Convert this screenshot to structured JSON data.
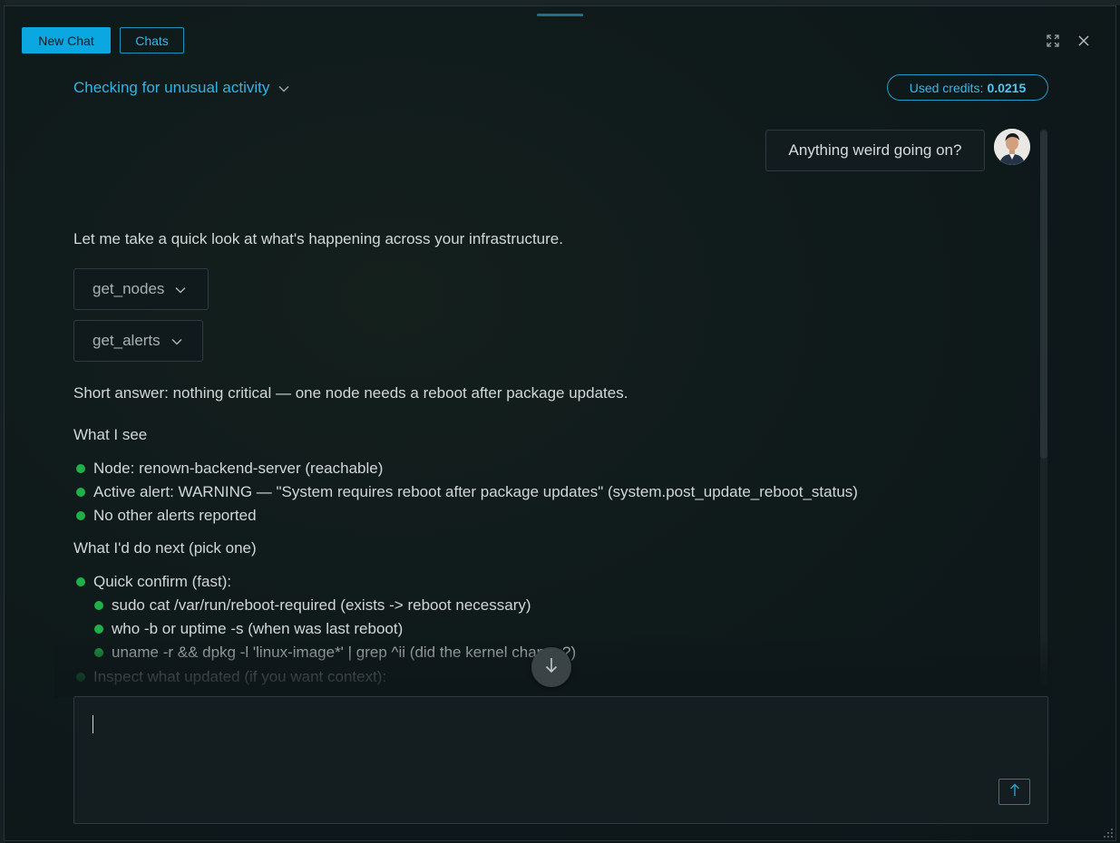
{
  "toolbar": {
    "new_chat_label": "New Chat",
    "chats_label": "Chats"
  },
  "header": {
    "conversation_title": "Checking for unusual activity",
    "credits_label": "Used credits:",
    "credits_value": "0.0215"
  },
  "messages": {
    "user_message": "Anything weird going on?",
    "assistant_intro": "Let me take a quick look at what's happening across your infrastructure.",
    "tool_calls": [
      "get_nodes",
      "get_alerts"
    ],
    "summary": "Short answer: nothing critical — one node needs a reboot after package updates.",
    "what_i_see_heading": "What I see",
    "observations": [
      "Node: renown-backend-server (reachable)",
      "Active alert: WARNING — \"System requires reboot after package updates\" (system.post_update_reboot_status)",
      "No other alerts reported"
    ],
    "next_steps_heading": "What I'd do next (pick one)",
    "next_steps": [
      {
        "label": "Quick confirm (fast):",
        "sub": [
          "sudo cat /var/run/reboot-required (exists -> reboot necessary)",
          "who -b or uptime -s (when was last reboot)",
          "uname -r && dpkg -l 'linux-image*' | grep ^ii (did the kernel change?)"
        ]
      },
      {
        "label": "Inspect what updated (if you want context):"
      }
    ]
  },
  "composer": {
    "value": ""
  },
  "icons": {
    "expand": "expand-icon",
    "close": "close-icon",
    "chevron": "chevron-down-icon",
    "scroll_down": "arrow-down-icon",
    "send": "arrow-up-icon"
  },
  "colors": {
    "accent": "#0aa7e0",
    "bullet": "#1fb04a",
    "background": "#0d1618"
  }
}
